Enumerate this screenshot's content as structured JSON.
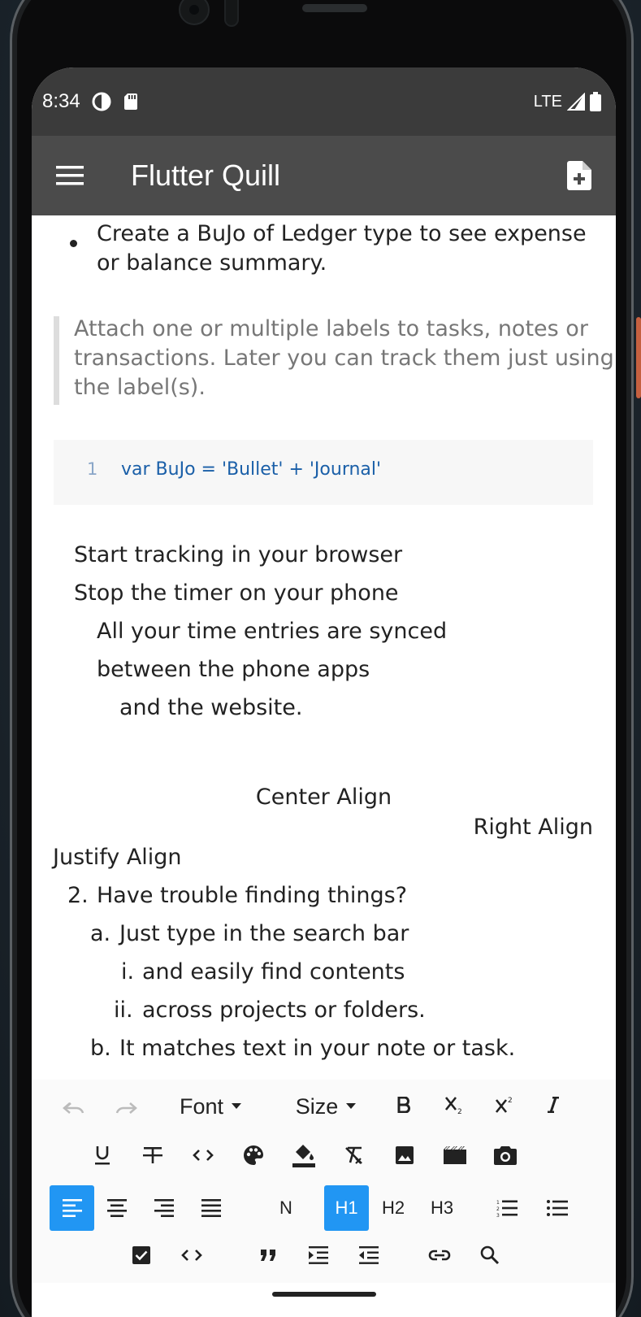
{
  "status_bar": {
    "time": "8:34",
    "network": "LTE",
    "icons": [
      "data-saver-icon",
      "sd-card-icon",
      "signal-icon",
      "battery-icon"
    ]
  },
  "app_bar": {
    "title": "Flutter Quill",
    "menu_icon": "hamburger-menu-icon",
    "action_icon": "new-document-icon"
  },
  "document": {
    "bullet_item": {
      "line1": "Create a BuJo of Ledger type to see expense",
      "line2": "or balance summary."
    },
    "quote": {
      "line1": "Attach one or multiple labels to tasks, notes or",
      "line2": "transactions. Later you can track them just using",
      "line3": "the label(s)."
    },
    "code": {
      "line_number": "1",
      "line_text": "var BuJo = 'Bullet' + 'Journal'"
    },
    "indented_lines": [
      "Start tracking in your browser",
      "Stop the timer on your phone",
      "All your time entries are synced",
      "between the phone apps",
      "and the website."
    ],
    "center_align": "Center Align",
    "right_align": "Right Align",
    "justify_align": "Justify Align",
    "ordered_list": {
      "item2_num": "2.",
      "item2_text": "Have trouble finding things?",
      "item_a_num": "a.",
      "item_a_text": "Just type in the search bar",
      "item_i_num": "i.",
      "item_i_text": "and easily find contents",
      "item_ii_num": "ii.",
      "item_ii_text": "across projects or folders.",
      "item_b_num": "b.",
      "item_b_text": "It matches text in your note or task."
    }
  },
  "toolbar": {
    "font_label": "Font",
    "size_label": "Size",
    "normal_label": "N",
    "h1_label": "H1",
    "h2_label": "H2",
    "h3_label": "H3",
    "active_alignment": "left",
    "active_heading": "H1",
    "accent_color": "#2196f3"
  },
  "colors": {
    "status_bar": "#3b3b3b",
    "app_bar": "#4b4b4b",
    "code_text": "#1a5fa8",
    "quote_text": "#777777"
  }
}
